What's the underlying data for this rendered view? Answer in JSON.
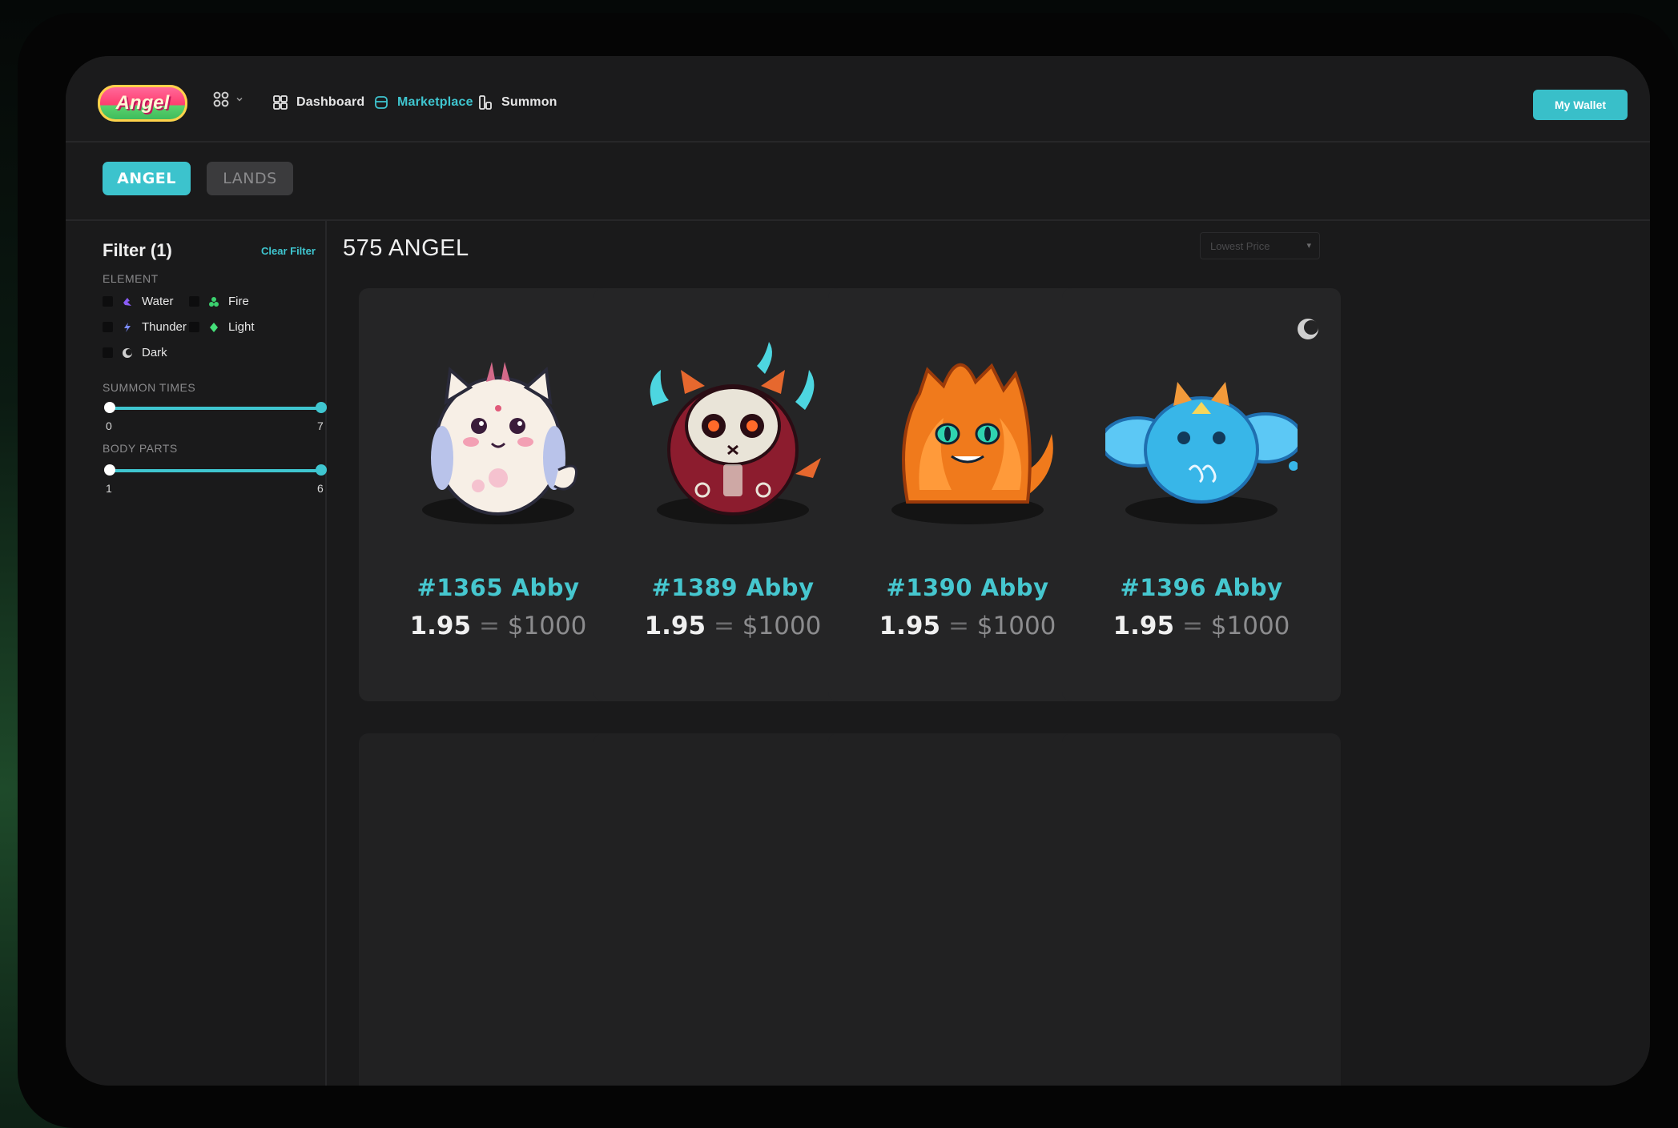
{
  "app": {
    "logo_text": "Angel"
  },
  "nav": {
    "items": [
      {
        "label": "Dashboard",
        "active": false,
        "icon": "dashboard-icon"
      },
      {
        "label": "Marketplace",
        "active": true,
        "icon": "marketplace-icon"
      },
      {
        "label": "Summon",
        "active": false,
        "icon": "summon-icon"
      }
    ],
    "wallet_label": "My Wallet"
  },
  "tabs": [
    {
      "label": "ANGEL",
      "active": true
    },
    {
      "label": "LANDS",
      "active": false
    }
  ],
  "filter": {
    "title": "Filter (1)",
    "clear_label": "Clear Filter",
    "element_label": "ELEMENT",
    "elements": [
      {
        "label": "Water",
        "icon": "water-icon",
        "color": "#8a5cf6"
      },
      {
        "label": "Fire",
        "icon": "fire-icon",
        "color": "#3bd16f"
      },
      {
        "label": "Thunder",
        "icon": "thunder-icon",
        "color": "#7b8cff"
      },
      {
        "label": "Light",
        "icon": "light-icon",
        "color": "#45e07a"
      },
      {
        "label": "Dark",
        "icon": "dark-icon",
        "color": "#cfcfcf"
      }
    ],
    "summon_label": "SUMMON TIMES",
    "summon_min": "0",
    "summon_max": "7",
    "body_label": "BODY PARTS",
    "body_min": "1",
    "body_max": "6"
  },
  "listing": {
    "count_label": "575 ANGEL",
    "sort_label": "Lowest Price",
    "cards": [
      {
        "name": "#1365  Abby",
        "eth": "1.95",
        "eq": "=",
        "usd": "$1000",
        "art": "white-angel"
      },
      {
        "name": "#1389  Abby",
        "eth": "1.95",
        "eq": "=",
        "usd": "$1000",
        "art": "red-angel"
      },
      {
        "name": "#1390  Abby",
        "eth": "1.95",
        "eq": "=",
        "usd": "$1000",
        "art": "fire-angel"
      },
      {
        "name": "#1396  Abby",
        "eth": "1.95",
        "eq": "=",
        "usd": "$1000",
        "art": "blue-angel"
      }
    ]
  },
  "colors": {
    "accent": "#3fc6d0",
    "background": "#1a1a1b",
    "card": "#252526"
  }
}
